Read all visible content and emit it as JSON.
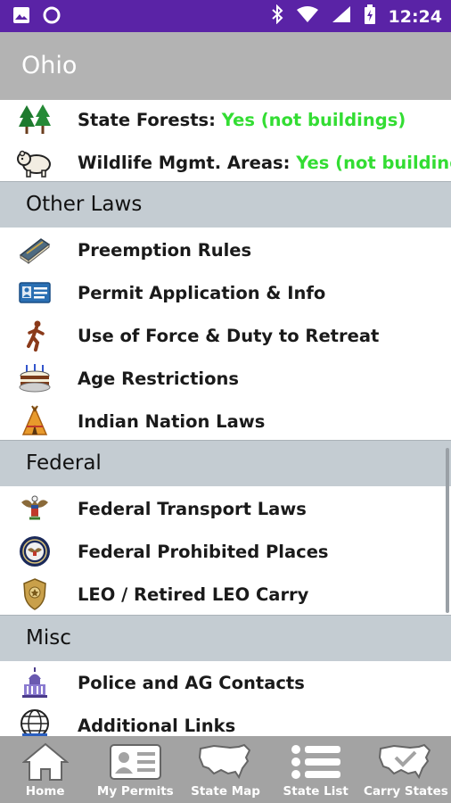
{
  "status_bar": {
    "time": "12:24",
    "icons": [
      "image-icon",
      "circle-icon",
      "bluetooth-icon",
      "wifi-icon",
      "signal-icon",
      "battery-icon"
    ]
  },
  "app_bar": {
    "title": "Ohio"
  },
  "rows_top": [
    {
      "label": "State Forests: ",
      "value": "Yes (not buildings)",
      "icon": "trees-icon"
    },
    {
      "label": "Wildlife Mgmt. Areas: ",
      "value": "Yes (not buildings)",
      "icon": "bear-icon"
    }
  ],
  "sections": {
    "other_laws": {
      "title": "Other Laws",
      "items": [
        {
          "label": "Preemption Rules",
          "icon": "book-icon"
        },
        {
          "label": "Permit Application & Info",
          "icon": "id-card-icon"
        },
        {
          "label": "Use of Force & Duty to Retreat",
          "icon": "running-man-icon"
        },
        {
          "label": "Age Restrictions",
          "icon": "birthday-cake-icon"
        },
        {
          "label": "Indian Nation Laws",
          "icon": "teepee-icon"
        }
      ]
    },
    "federal": {
      "title": "Federal",
      "items": [
        {
          "label": "Federal Transport Laws",
          "icon": "eagle-seal-icon"
        },
        {
          "label": "Federal Prohibited Places",
          "icon": "presidential-seal-icon"
        },
        {
          "label": "LEO / Retired LEO Carry",
          "icon": "police-badge-icon"
        }
      ]
    },
    "misc": {
      "title": "Misc",
      "items": [
        {
          "label": "Police and AG Contacts",
          "icon": "capitol-icon"
        },
        {
          "label": "Additional Links",
          "icon": "globe-www-icon"
        }
      ]
    }
  },
  "bottom_nav": [
    {
      "label": "Home",
      "icon": "home-icon"
    },
    {
      "label": "My Permits",
      "icon": "id-card-icon"
    },
    {
      "label": "State Map",
      "icon": "usa-map-icon"
    },
    {
      "label": "State List",
      "icon": "list-icon"
    },
    {
      "label": "Carry States",
      "icon": "usa-check-map-icon"
    }
  ],
  "colors": {
    "status_bar": "#5a23a6",
    "app_bar": "#b3b3b3",
    "section_header": "#c4ccd2",
    "yes_value": "#33dd33",
    "bottom_bar": "#a3a3a3"
  }
}
